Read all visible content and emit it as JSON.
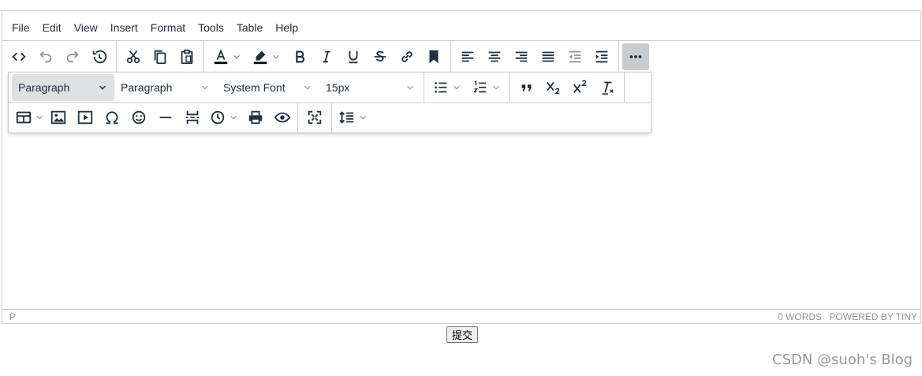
{
  "menubar": {
    "items": [
      "File",
      "Edit",
      "View",
      "Insert",
      "Format",
      "Tools",
      "Table",
      "Help"
    ]
  },
  "toolbar": {
    "row1_icons": [
      "code-icon",
      "undo-icon",
      "redo-icon",
      "restore-draft-icon",
      "cut-icon",
      "copy-icon",
      "paste-icon",
      "text-color-icon",
      "highlight-color-icon",
      "bold-icon",
      "italic-icon",
      "underline-icon",
      "strikethrough-icon",
      "link-icon",
      "bookmark-icon",
      "align-left-icon",
      "align-center-icon",
      "align-right-icon",
      "align-justify-icon",
      "outdent-icon",
      "indent-icon",
      "more-icon"
    ],
    "blocks_value": "Paragraph",
    "format_value": "Paragraph",
    "font_value": "System Font",
    "size_value": "15px"
  },
  "status": {
    "path": "P",
    "words": "0 WORDS",
    "powered": "POWERED BY TINY"
  },
  "submit_label": "提交",
  "watermark": "CSDN @suoh's Blog",
  "colors": {
    "border": "#cccccc",
    "icon": "#222f3e",
    "active_bg": "#dee0e2",
    "more_bg": "#c8cbcf"
  }
}
